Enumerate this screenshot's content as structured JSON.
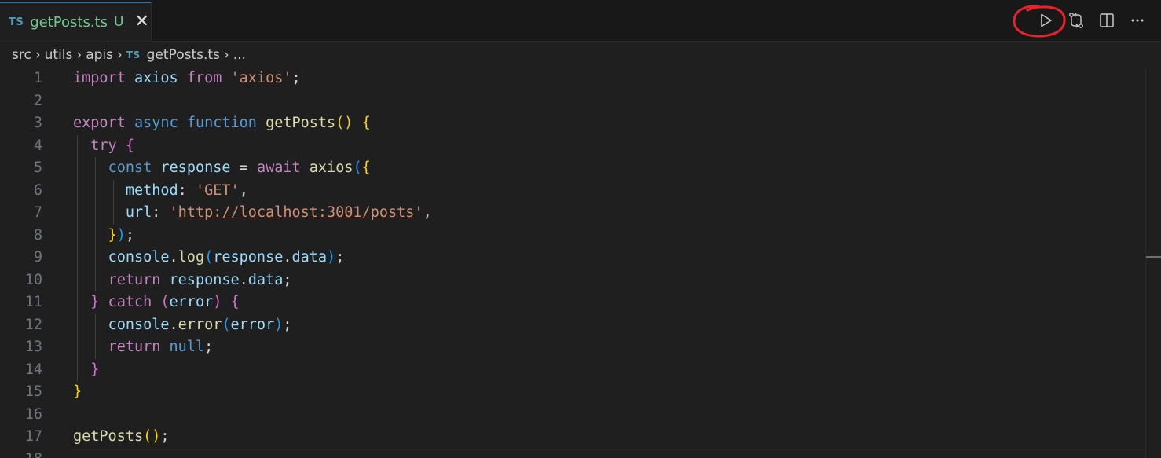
{
  "tab": {
    "lang_badge": "TS",
    "filename": "getPosts.ts",
    "git_status": "U",
    "close_glyph": "✕"
  },
  "actions": [
    {
      "name": "run-icon",
      "tooltip": ""
    },
    {
      "name": "compare-changes-icon",
      "tooltip": ""
    },
    {
      "name": "split-editor-icon",
      "tooltip": ""
    },
    {
      "name": "more-actions-icon",
      "tooltip": ""
    }
  ],
  "annotation_color": "#e8212b",
  "breadcrumb": {
    "items": [
      "src",
      "utils",
      "apis"
    ],
    "file_badge": "TS",
    "file": "getPosts.ts",
    "more": "...",
    "separator": "›"
  },
  "editor": {
    "active_line": 18,
    "lines": [
      {
        "n": "1",
        "tokens": [
          [
            "kw",
            "import"
          ],
          [
            "txt",
            " "
          ],
          [
            "var",
            "axios"
          ],
          [
            "txt",
            " "
          ],
          [
            "kw",
            "from"
          ],
          [
            "txt",
            " "
          ],
          [
            "str",
            "'axios'"
          ],
          [
            "txt",
            ";"
          ]
        ]
      },
      {
        "n": "2",
        "tokens": []
      },
      {
        "n": "3",
        "tokens": [
          [
            "kw",
            "export"
          ],
          [
            "txt",
            " "
          ],
          [
            "st",
            "async"
          ],
          [
            "txt",
            " "
          ],
          [
            "st",
            "function"
          ],
          [
            "txt",
            " "
          ],
          [
            "fn",
            "getPosts"
          ],
          [
            "p1",
            "()"
          ],
          [
            "txt",
            " "
          ],
          [
            "p1",
            "{"
          ]
        ]
      },
      {
        "n": "4",
        "tokens": [
          [
            "txt",
            "  "
          ],
          [
            "kw",
            "try"
          ],
          [
            "txt",
            " "
          ],
          [
            "p2",
            "{"
          ]
        ]
      },
      {
        "n": "5",
        "tokens": [
          [
            "txt",
            "    "
          ],
          [
            "st",
            "const"
          ],
          [
            "txt",
            " "
          ],
          [
            "var",
            "response"
          ],
          [
            "txt",
            " = "
          ],
          [
            "kw",
            "await"
          ],
          [
            "txt",
            " "
          ],
          [
            "fn",
            "axios"
          ],
          [
            "p3",
            "("
          ],
          [
            "p1",
            "{"
          ]
        ]
      },
      {
        "n": "6",
        "tokens": [
          [
            "txt",
            "      "
          ],
          [
            "var",
            "method"
          ],
          [
            "txt",
            ": "
          ],
          [
            "str",
            "'GET'"
          ],
          [
            "txt",
            ","
          ]
        ]
      },
      {
        "n": "7",
        "tokens": [
          [
            "txt",
            "      "
          ],
          [
            "var",
            "url"
          ],
          [
            "txt",
            ": "
          ],
          [
            "str",
            "'"
          ],
          [
            "str url",
            "http://localhost:3001/posts"
          ],
          [
            "str",
            "'"
          ],
          [
            "txt",
            ","
          ]
        ]
      },
      {
        "n": "8",
        "tokens": [
          [
            "txt",
            "    "
          ],
          [
            "p1",
            "}"
          ],
          [
            "p3",
            ")"
          ],
          [
            "txt",
            ";"
          ]
        ]
      },
      {
        "n": "9",
        "tokens": [
          [
            "txt",
            "    "
          ],
          [
            "var",
            "console"
          ],
          [
            "txt",
            "."
          ],
          [
            "fn",
            "log"
          ],
          [
            "p3",
            "("
          ],
          [
            "var",
            "response"
          ],
          [
            "txt",
            "."
          ],
          [
            "var",
            "data"
          ],
          [
            "p3",
            ")"
          ],
          [
            "txt",
            ";"
          ]
        ]
      },
      {
        "n": "10",
        "tokens": [
          [
            "txt",
            "    "
          ],
          [
            "kw",
            "return"
          ],
          [
            "txt",
            " "
          ],
          [
            "var",
            "response"
          ],
          [
            "txt",
            "."
          ],
          [
            "var",
            "data"
          ],
          [
            "txt",
            ";"
          ]
        ]
      },
      {
        "n": "11",
        "tokens": [
          [
            "txt",
            "  "
          ],
          [
            "p2",
            "}"
          ],
          [
            "txt",
            " "
          ],
          [
            "kw",
            "catch"
          ],
          [
            "txt",
            " "
          ],
          [
            "p2",
            "("
          ],
          [
            "var",
            "error"
          ],
          [
            "p2",
            ")"
          ],
          [
            "txt",
            " "
          ],
          [
            "p2",
            "{"
          ]
        ]
      },
      {
        "n": "12",
        "tokens": [
          [
            "txt",
            "    "
          ],
          [
            "var",
            "console"
          ],
          [
            "txt",
            "."
          ],
          [
            "fn",
            "error"
          ],
          [
            "p3",
            "("
          ],
          [
            "var",
            "error"
          ],
          [
            "p3",
            ")"
          ],
          [
            "txt",
            ";"
          ]
        ]
      },
      {
        "n": "13",
        "tokens": [
          [
            "txt",
            "    "
          ],
          [
            "kw",
            "return"
          ],
          [
            "txt",
            " "
          ],
          [
            "st",
            "null"
          ],
          [
            "txt",
            ";"
          ]
        ]
      },
      {
        "n": "14",
        "tokens": [
          [
            "txt",
            "  "
          ],
          [
            "p2",
            "}"
          ]
        ]
      },
      {
        "n": "15",
        "tokens": [
          [
            "p1",
            "}"
          ]
        ]
      },
      {
        "n": "16",
        "tokens": []
      },
      {
        "n": "17",
        "tokens": [
          [
            "fn",
            "getPosts"
          ],
          [
            "p1",
            "()"
          ],
          [
            "txt",
            ";"
          ]
        ]
      },
      {
        "n": "18",
        "tokens": []
      }
    ]
  }
}
